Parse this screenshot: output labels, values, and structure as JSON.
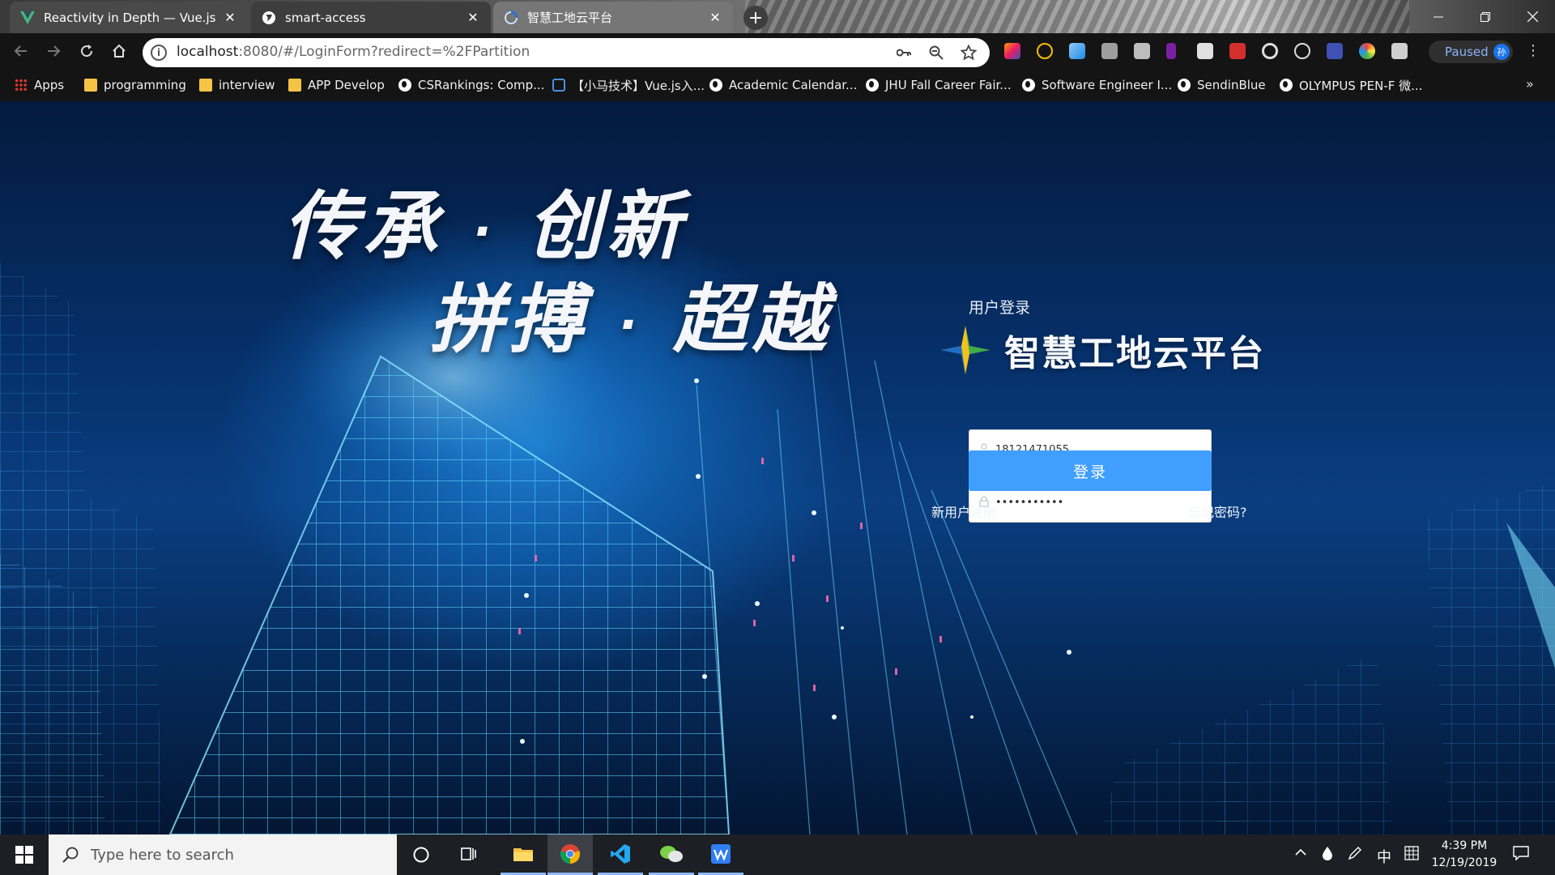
{
  "browser": {
    "tabs": [
      {
        "title": "Reactivity in Depth — Vue.js",
        "active": false
      },
      {
        "title": "smart-access",
        "active": false
      },
      {
        "title": "智慧工地云平台",
        "active": true
      }
    ],
    "close_glyph": "✕",
    "new_tab_glyph": "+",
    "url_host": "localhost",
    "url_path": ":8080/#/LoginForm?redirect=%2FPartition",
    "profile_status": "Paused",
    "profile_avatar": "孙"
  },
  "bookmarks": [
    {
      "label": "Apps",
      "icon": "apps-icon"
    },
    {
      "label": "programming",
      "icon": "folder-icon"
    },
    {
      "label": "interview",
      "icon": "folder-icon"
    },
    {
      "label": "APP Develop",
      "icon": "folder-icon"
    },
    {
      "label": "CSRankings: Comp...",
      "icon": "globe-icon"
    },
    {
      "label": "【小马技术】Vue.js入...",
      "icon": "tv-icon"
    },
    {
      "label": "Academic Calendar...",
      "icon": "globe-icon"
    },
    {
      "label": "JHU Fall Career Fair...",
      "icon": "globe-icon"
    },
    {
      "label": "Software Engineer I...",
      "icon": "globe-icon"
    },
    {
      "label": "SendinBlue",
      "icon": "globe-icon"
    },
    {
      "label": "OLYMPUS PEN-F 微...",
      "icon": "globe-icon"
    }
  ],
  "page": {
    "slogan_line1_left": "传承",
    "slogan_line1_right": "创新",
    "slogan_line2_left": "拼搏",
    "slogan_line2_right": "超越",
    "slogan_dot": "·",
    "brand_name": "智慧工地云平台",
    "login_title": "用户登录",
    "username_value": "18121471055",
    "password_value": "•••••••••••",
    "login_button": "登录",
    "register_link": "新用户注册",
    "forgot_link": "忘记密码?"
  },
  "taskbar": {
    "search_placeholder": "Type here to search",
    "ime_lang": "中",
    "time": "4:39 PM",
    "date": "12/19/2019"
  },
  "colors": {
    "accent": "#409eff",
    "page_bg": "#0a3e80"
  }
}
